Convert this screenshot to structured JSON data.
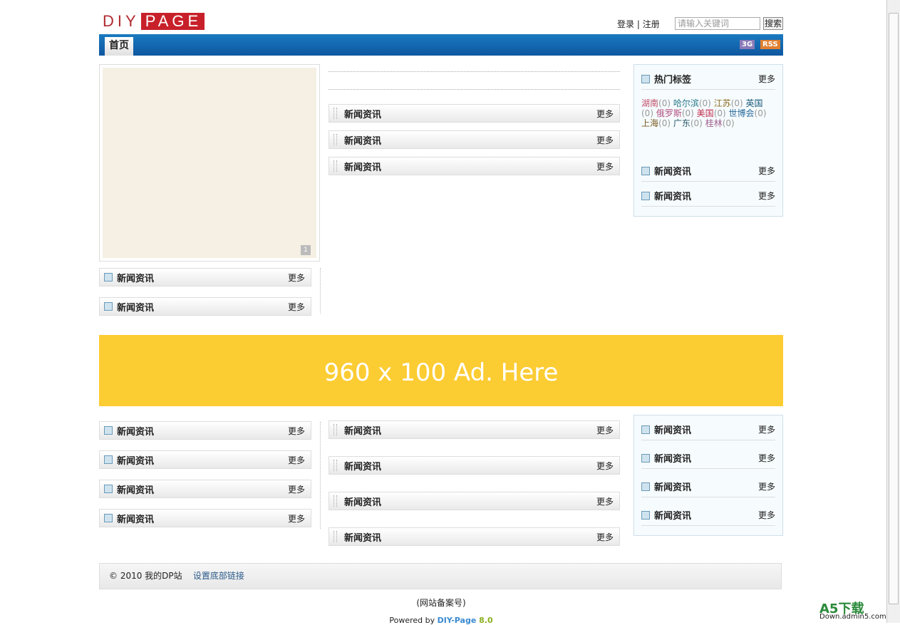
{
  "logo": {
    "part1": "DIY",
    "part2": "PAGE"
  },
  "header": {
    "login": "登录",
    "sep": "|",
    "register": "注册",
    "search_placeholder": "请输入关键词",
    "search_button": "搜索"
  },
  "nav": {
    "home": "首页",
    "badge_3g": "3G",
    "badge_rss": "RSS"
  },
  "block_title": "新闻资讯",
  "more": "更多",
  "hot_tags": {
    "title": "热门标签",
    "tags": [
      {
        "name": "湖南",
        "count": "(0)",
        "color": "#c0506a"
      },
      {
        "name": "哈尔滨",
        "count": "(0)",
        "color": "#2a7a8a"
      },
      {
        "name": "江苏",
        "count": "(0)",
        "color": "#8a6a20"
      },
      {
        "name": "英国",
        "count": "(0)",
        "color": "#1a5a7a"
      },
      {
        "name": "俄罗斯",
        "count": "(0)",
        "color": "#b05080"
      },
      {
        "name": "美国",
        "count": "(0)",
        "color": "#c03050"
      },
      {
        "name": "世博会",
        "count": "(0)",
        "color": "#2a6a9a"
      },
      {
        "name": "上海",
        "count": "(0)",
        "color": "#7a5a20"
      },
      {
        "name": "广东",
        "count": "(0)",
        "color": "#2a5a6a"
      },
      {
        "name": "桂林",
        "count": "(0)",
        "color": "#a06090"
      }
    ]
  },
  "slideshow": {
    "page": "1"
  },
  "ad": {
    "text": "960 x 100 Ad. Here"
  },
  "footer": {
    "copyright": "© 2010 我的DP站",
    "link": "设置底部链接",
    "icp": "(网站备案号)",
    "powered": "Powered by ",
    "brand": "DIY-Page",
    "version": " 8.0"
  },
  "watermark": {
    "title": "A5下载",
    "url": "Down.admin5.com"
  }
}
